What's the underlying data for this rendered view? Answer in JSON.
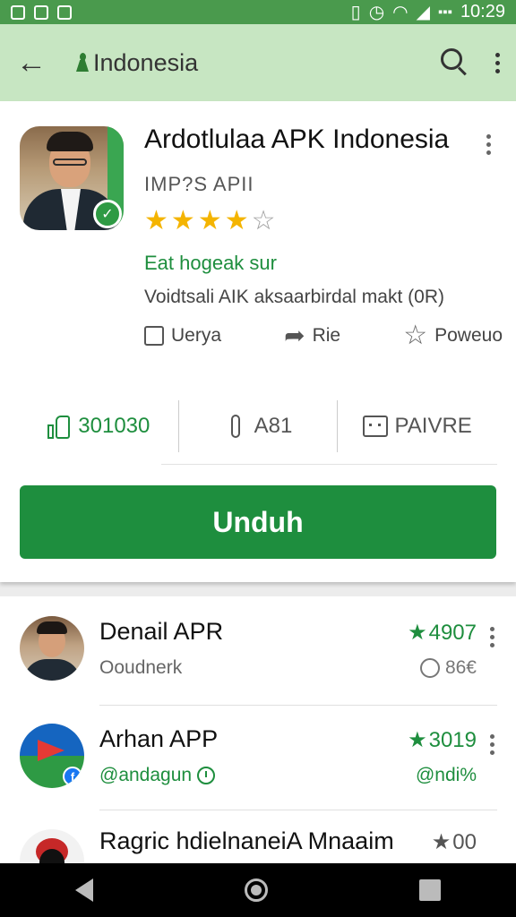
{
  "status_bar": {
    "time": "10:29",
    "left_icons": [
      "image-icon",
      "message-icon",
      "image-icon"
    ],
    "right_icons": [
      "vibrate-icon",
      "alarm-icon",
      "wifi-icon",
      "signal-icon",
      "battery-icon"
    ],
    "small_text": "▪▪▪"
  },
  "app_bar": {
    "back_glyph": "←",
    "title": "Indonesia"
  },
  "app": {
    "title": "Ardotlulaa APK Indonesia",
    "developer": "IMP?S APII",
    "rating_stars": 4,
    "rating_max": 5,
    "tagline": "Eat hogeak sur",
    "description": "Voidtsali AIK aksaarbirdal makt (0R)",
    "actions": [
      {
        "label": "Uerya",
        "icon": "wishlist-icon"
      },
      {
        "label": "Rie",
        "icon": "share-icon"
      },
      {
        "label": "Poweuo",
        "icon": "star-outline-icon"
      }
    ],
    "stats": [
      {
        "value": "301030",
        "icon": "thumbs-up-icon"
      },
      {
        "value": "A81",
        "icon": "hand-icon"
      },
      {
        "value": "PAIVRE",
        "icon": "content-rating-icon"
      }
    ],
    "install_label": "Unduh"
  },
  "list": [
    {
      "name": "Denail APR",
      "sub": "Ooudnerk",
      "rating": "4907",
      "meta": "86€",
      "icon": "person-avatar-icon"
    },
    {
      "name": "Arhan APP",
      "sub": "@andagun",
      "rating": "3019",
      "meta": "@ndi%",
      "icon": "map-app-icon"
    },
    {
      "name": "Ragric hdielnaneiA Mnaaim",
      "sub": "",
      "rating": "00",
      "meta": "",
      "icon": "person-avatar-icon"
    }
  ],
  "colors": {
    "status_bar": "#4a9a4d",
    "app_bar": "#c7e6c2",
    "accent_green": "#1e8e3e",
    "star_gold": "#f4b400"
  }
}
